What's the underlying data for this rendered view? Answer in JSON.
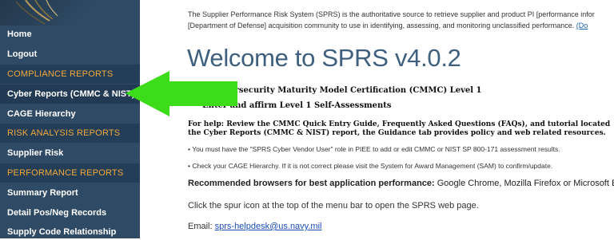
{
  "sidebar": {
    "items": [
      {
        "type": "link",
        "label": "Home"
      },
      {
        "type": "link",
        "label": "Logout"
      },
      {
        "type": "header",
        "label": "COMPLIANCE REPORTS"
      },
      {
        "type": "link",
        "label": "Cyber Reports (CMMC & NIST)"
      },
      {
        "type": "link",
        "label": "CAGE Hierarchy"
      },
      {
        "type": "header",
        "label": "RISK ANALYSIS REPORTS"
      },
      {
        "type": "link",
        "label": "Supplier Risk"
      },
      {
        "type": "header",
        "label": "PERFORMANCE REPORTS"
      },
      {
        "type": "link",
        "label": "Summary Report"
      },
      {
        "type": "link",
        "label": "Detail Pos/Neg Records"
      },
      {
        "type": "link",
        "label": "Supply Code Relationship"
      }
    ]
  },
  "main": {
    "intro_line1": "The Supplier Performance Risk System (SPRS) is the authoritative source to retrieve supplier and product PI [performance infor",
    "intro_line2": "[Department of Defense] acquisition community to use in identifying, assessing, and monitoring unclassified performance.",
    "intro_link": "(Do",
    "welcome": "Welcome to SPRS v4.0.2",
    "cmmc_title": "NEW Cybersecurity Maturity Model Certification (CMMC) Level 1",
    "cmmc_sub": "Enter and affirm Level 1 Self-Assessments",
    "help_line1": "For help:  Review the CMMC Quick Entry Guide, Frequently Asked Questions (FAQs), and tutorial located",
    "help_line2": "the Cyber Reports (CMMC & NIST) report, the Guidance tab provides policy and web related resources.",
    "bullet1": "You must have the \"SPRS Cyber Vendor User\" role in PIEE to add or edit CMMC or NIST SP 800-171 assessment results.",
    "bullet2": "Check your CAGE Hierarchy. If it is not correct please visit the System for Award Management (SAM) to confirm/update.",
    "browsers_label": "Recommended browsers for best application performance:",
    "browsers_value": " Google Chrome, Mozilla Firefox or Microsoft Edge.",
    "spur_text": "Click the spur icon at the top of the menu bar to open the SPRS web page.",
    "email_label": "Email: ",
    "email_link": "sprs-helpdesk@us.navy.mil"
  },
  "colors": {
    "sidebar_bg": "#2f4a64",
    "header_text": "#f0a93a",
    "welcome_text": "#3e5f7e",
    "arrow": "#3ddc1a"
  }
}
